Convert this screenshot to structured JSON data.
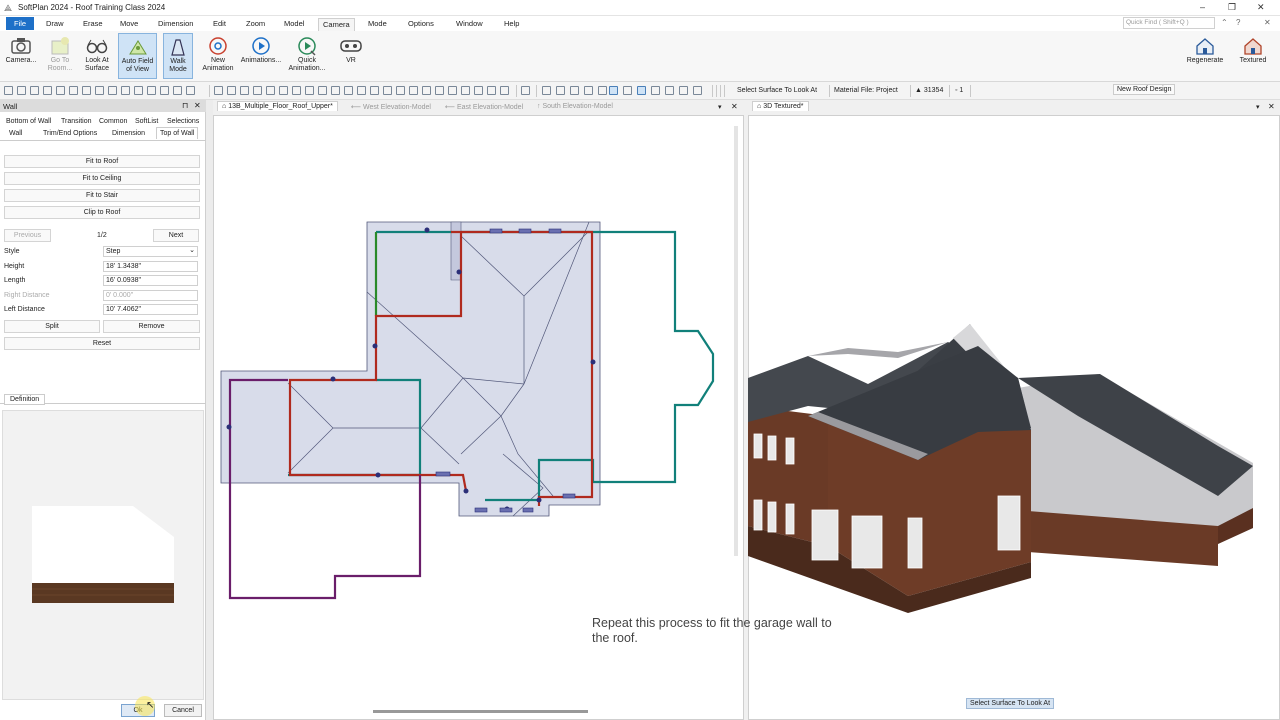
{
  "app": {
    "title": "SoftPlan 2024 - Roof Training Class 2024",
    "window_controls": [
      "–",
      "❐",
      "✕"
    ]
  },
  "menu": {
    "items": [
      "File",
      "Draw",
      "Erase",
      "Move",
      "Dimension",
      "Edit",
      "Zoom",
      "Model",
      "Camera",
      "Mode",
      "Options",
      "Window",
      "Help"
    ],
    "active": "Camera",
    "quick_find_placeholder": "Quick Find ( Shift+Q )"
  },
  "ribbon": {
    "buttons": [
      {
        "label1": "Camera...",
        "label2": "",
        "icon": "camera-icon"
      },
      {
        "label1": "Go To",
        "label2": "Room...",
        "icon": "go-to-room-icon"
      },
      {
        "label1": "Look At",
        "label2": "Surface",
        "icon": "glasses-icon"
      },
      {
        "label1": "Auto Field",
        "label2": "of View",
        "icon": "auto-field-icon"
      },
      {
        "label1": "Walk",
        "label2": "Mode",
        "icon": "walk-mode-icon"
      },
      {
        "label1": "New",
        "label2": "Animation",
        "icon": "new-animation-icon"
      },
      {
        "label1": "Animations...",
        "label2": "",
        "icon": "play-icon"
      },
      {
        "label1": "Quick",
        "label2": "Animation...",
        "icon": "quick-animation-icon"
      },
      {
        "label1": "VR",
        "label2": "",
        "icon": "vr-icon"
      }
    ],
    "right_buttons": [
      {
        "label": "Regenerate",
        "icon": "regenerate-house-icon"
      },
      {
        "label": "Textured",
        "icon": "textured-house-icon"
      }
    ]
  },
  "toolbar": {
    "select_surface": "Select Surface To Look At",
    "material_file": "Material File: Project",
    "count": "▲ 31354",
    "layer": "◦ 1",
    "new_roof_design": "New Roof Design"
  },
  "left_panel": {
    "title": "Wall",
    "tabs_row1": [
      "Bottom of Wall",
      "Transition",
      "Common",
      "SoftList",
      "Selections"
    ],
    "tabs_row2": [
      "Wall",
      "Trim/End Options",
      "Dimension",
      "Top of Wall"
    ],
    "buttons": [
      "Fit to Roof",
      "Fit to Ceiling",
      "Fit to Stair",
      "Clip to Roof"
    ],
    "pager": {
      "previous": "Previous",
      "position": "1/2",
      "next": "Next"
    },
    "fields": [
      {
        "label": "Style",
        "value": "Step",
        "dim": false
      },
      {
        "label": "Height",
        "value": "18' 1.3438\"",
        "dim": false
      },
      {
        "label": "Length",
        "value": "16' 0.0938\"",
        "dim": false
      },
      {
        "label": "Right Distance",
        "value": "0' 0.000\"",
        "dim": true
      },
      {
        "label": "Left Distance",
        "value": "10' 7.4062\"",
        "dim": false
      }
    ],
    "split": "Split",
    "remove": "Remove",
    "reset": "Reset",
    "definition_tab": "Definition",
    "ok": "Ok",
    "cancel": "Cancel"
  },
  "views": {
    "tabs": [
      "13B_Multiple_Floor_Roof_Upper*",
      "West Elevation-Model",
      "East Elevation-Model",
      "South Elevation-Model"
    ],
    "active_tab": "13B_Multiple_Floor_Roof_Upper*",
    "view3d_tab": "3D Textured*",
    "status_3d": "Select Surface To Look At"
  },
  "caption": {
    "line1": "Repeat this process to fit the garage wall to",
    "line2": "the roof."
  },
  "colors": {
    "accent": "#1e70c8",
    "roof_fill": "#d8dcea",
    "wall_red": "#b02a1e",
    "wall_teal": "#11807a",
    "wall_purple": "#6a1e6a",
    "wall_green": "#2a8a2a",
    "brick": "#6a3a26",
    "roof_shingle": "#3e4248"
  }
}
